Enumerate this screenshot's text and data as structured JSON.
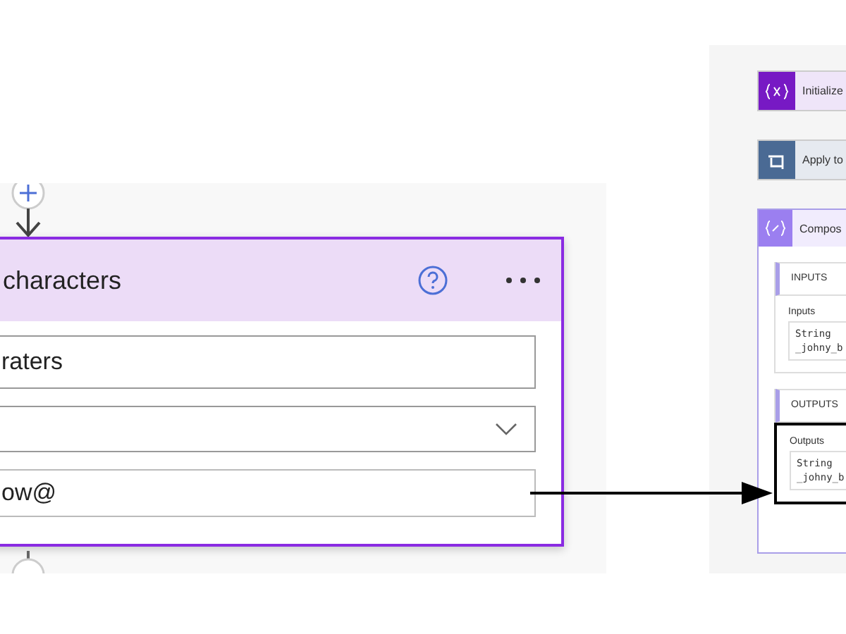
{
  "left_panel": {
    "card": {
      "title": "characters",
      "fields": [
        {
          "kind": "text",
          "value": "raters"
        },
        {
          "kind": "dropdown"
        },
        {
          "kind": "text",
          "value": "ow@"
        }
      ]
    }
  },
  "right_panel": {
    "actions": [
      {
        "kind": "variable",
        "label": "Initialize"
      },
      {
        "kind": "loop",
        "label": "Apply to"
      }
    ],
    "compose": {
      "title": "Compos",
      "sections": [
        {
          "heading": "INPUTS",
          "label": "Inputs",
          "lines": [
            "String",
            "_johny_b"
          ],
          "highlighted": false
        },
        {
          "heading": "OUTPUTS",
          "label": "Outputs",
          "lines": [
            "String",
            "_johny_b"
          ],
          "highlighted": true
        }
      ]
    }
  }
}
